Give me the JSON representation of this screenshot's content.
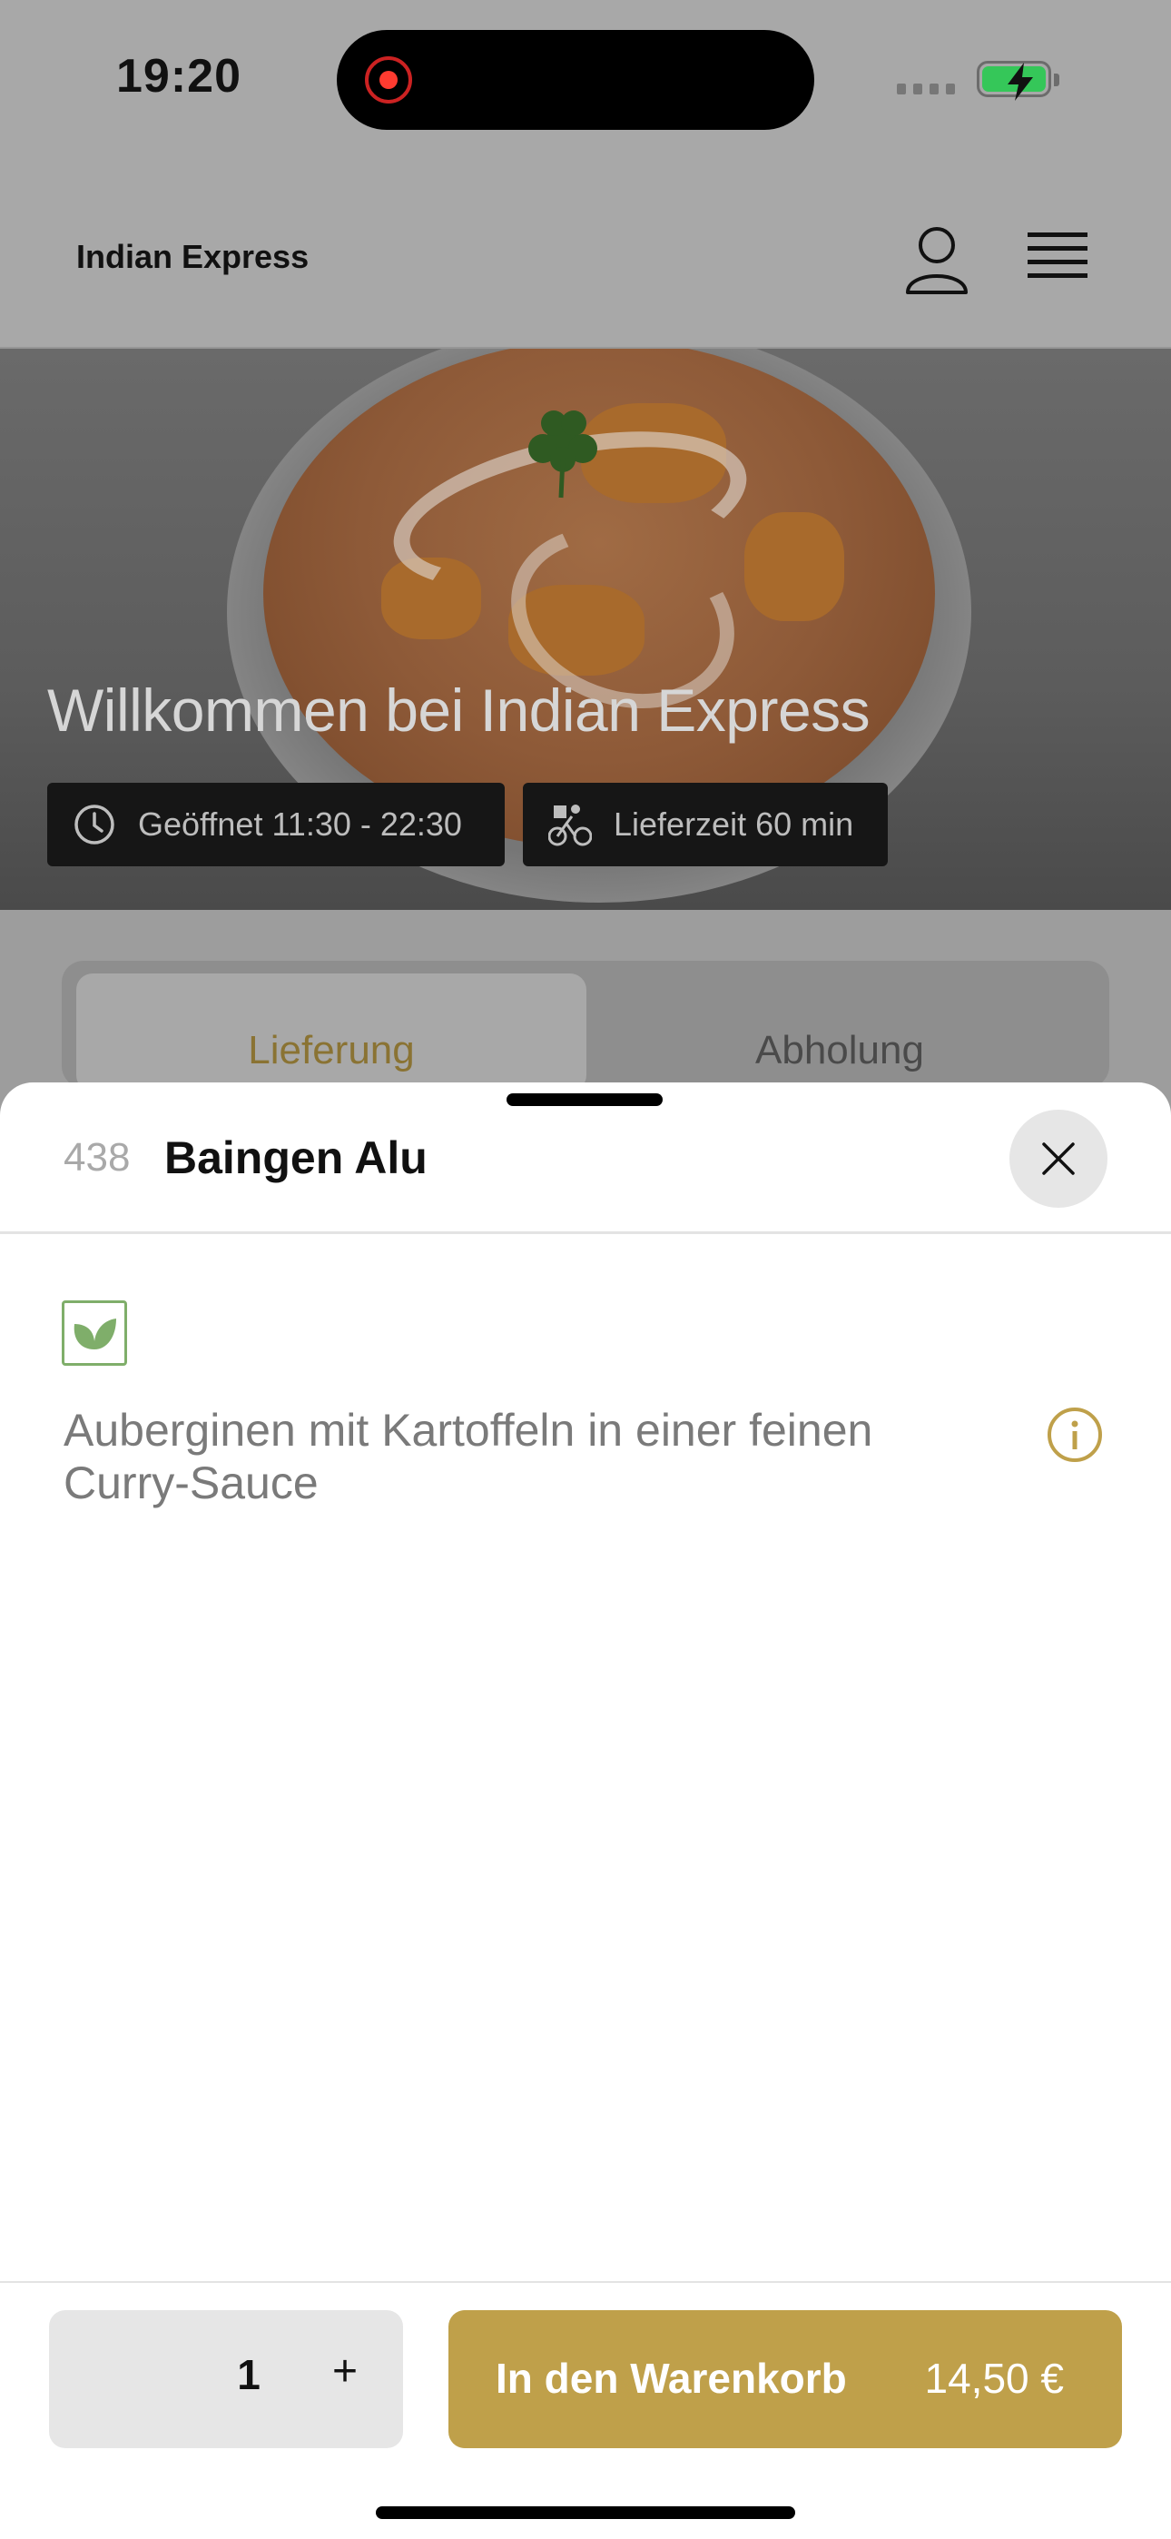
{
  "status_bar": {
    "time": "19:20"
  },
  "header": {
    "brand": "Indian Express"
  },
  "hero": {
    "title": "Willkommen bei Indian Express",
    "opening_hours": "Geöffnet 11:30 - 22:30",
    "delivery_time": "Lieferzeit 60 min"
  },
  "tabs": [
    {
      "label": "Lieferung",
      "active": true
    },
    {
      "label": "Abholung",
      "active": false
    }
  ],
  "item": {
    "number": "438",
    "name": "Baingen Alu",
    "description": "Auberginen mit Kartoffeln in einer feinen Curry-Sauce"
  },
  "footer": {
    "quantity": "1",
    "plus_label": "+",
    "add_to_cart_label": "In den Warenkorb",
    "price": "14,50 €"
  },
  "colors": {
    "accent": "#bfa04a",
    "veg_green": "#7fae6a",
    "battery_green": "#35c759"
  }
}
